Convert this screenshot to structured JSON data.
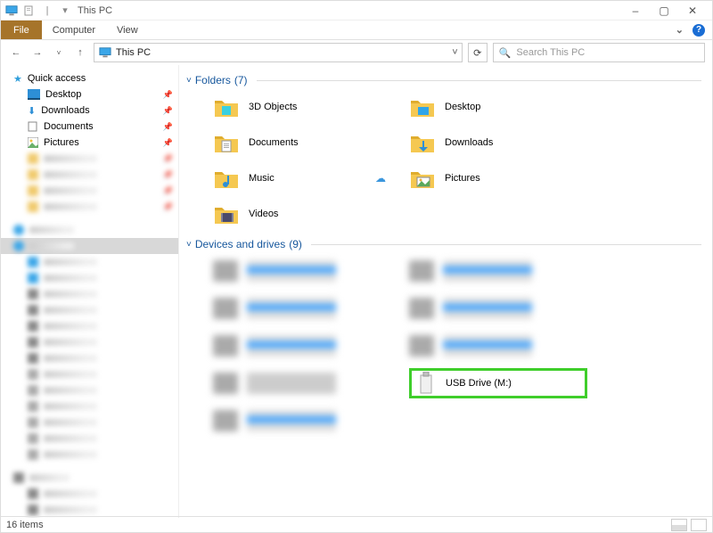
{
  "window": {
    "title": "This PC",
    "controls": {
      "minimize": "–",
      "maximize": "▢",
      "close": "✕"
    }
  },
  "quick_access": {
    "save_icon": "save-icon",
    "doc_icon": "doc-icon",
    "caret": "▾"
  },
  "menubar": {
    "file": "File",
    "computer": "Computer",
    "view": "View",
    "help_down": "⌄",
    "help_icon": "?"
  },
  "addressbar": {
    "back": "←",
    "forward": "→",
    "dropdown": "˅",
    "up": "↑",
    "location": "This PC",
    "chevron": "˅",
    "refresh": "⟳"
  },
  "search": {
    "icon": "🔍",
    "placeholder": "Search This PC"
  },
  "sidebar": {
    "quick_access": "Quick access",
    "items": [
      {
        "label": "Desktop"
      },
      {
        "label": "Downloads"
      },
      {
        "label": "Documents"
      },
      {
        "label": "Pictures"
      }
    ]
  },
  "sections": {
    "folders": {
      "label": "Folders",
      "count": "(7)"
    },
    "drives": {
      "label": "Devices and drives",
      "count": "(9)"
    }
  },
  "folders": [
    {
      "label": "3D Objects"
    },
    {
      "label": "Desktop"
    },
    {
      "label": "Documents"
    },
    {
      "label": "Downloads"
    },
    {
      "label": "Music"
    },
    {
      "label": "Pictures"
    },
    {
      "label": "Videos"
    }
  ],
  "drives": {
    "usb": "USB Drive (M:)"
  },
  "statusbar": {
    "items": "16 items"
  }
}
